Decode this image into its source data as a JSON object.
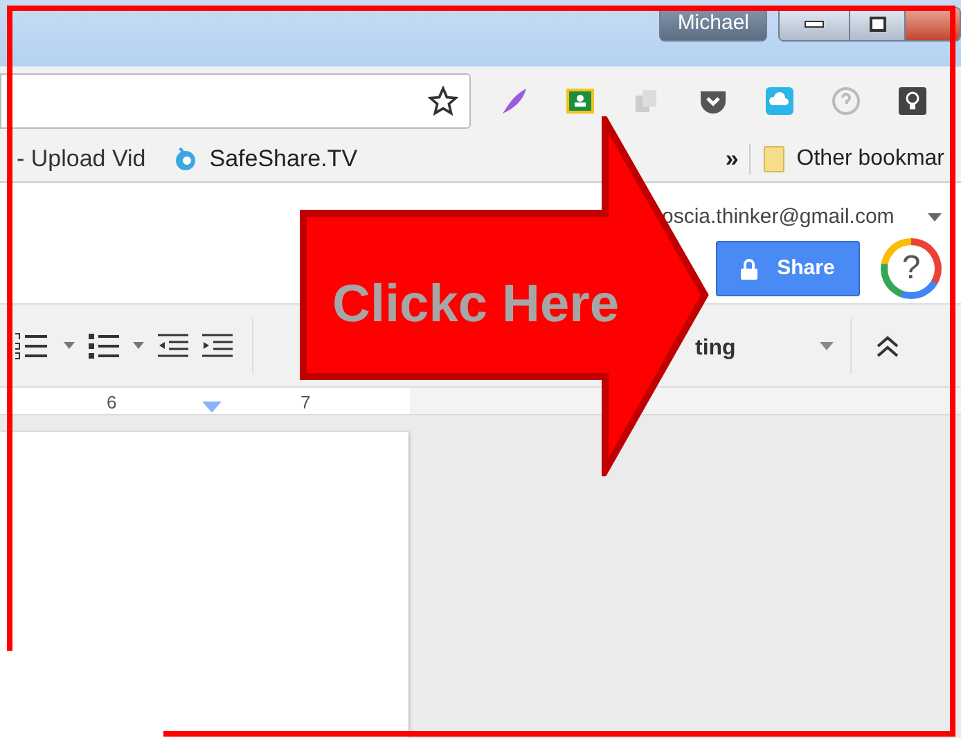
{
  "window": {
    "user": "Michael"
  },
  "bookmarks_bar": {
    "items": [
      {
        "label": "- Upload Vid",
        "kind": "plain"
      },
      {
        "label": "SafeShare.TV",
        "kind": "site"
      }
    ],
    "overflow": "»",
    "other": "Other bookmar"
  },
  "docs_header": {
    "account": "oscia.thinker@gmail.com",
    "share": "Share",
    "help": "?"
  },
  "toolbar": {
    "style_label": "ting"
  },
  "ruler": {
    "labels": [
      "6",
      "7"
    ]
  },
  "annotation": {
    "text": "Clickc Here"
  }
}
